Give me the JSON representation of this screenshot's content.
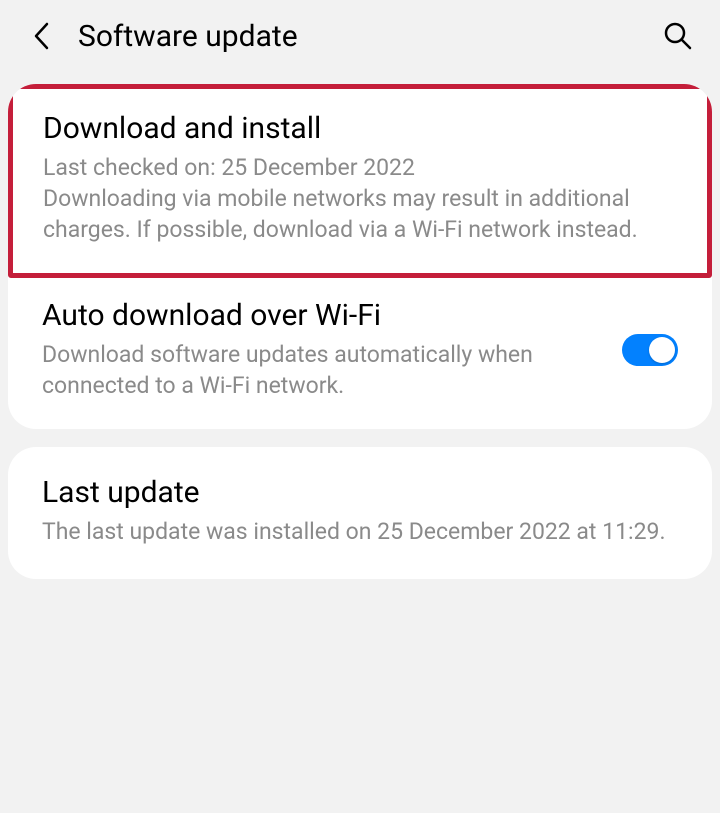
{
  "header": {
    "title": "Software update"
  },
  "sections": {
    "download_install": {
      "title": "Download and install",
      "last_checked": "Last checked on: 25 December 2022",
      "description": "Downloading via mobile networks may result in additional charges. If possible, download via a Wi-Fi network instead."
    },
    "auto_download": {
      "title": "Auto download over Wi-Fi",
      "description": "Download software updates automatically when connected to a Wi-Fi network.",
      "enabled": true
    },
    "last_update": {
      "title": "Last update",
      "description": "The last update was installed on 25 December 2022 at 11:29."
    }
  }
}
